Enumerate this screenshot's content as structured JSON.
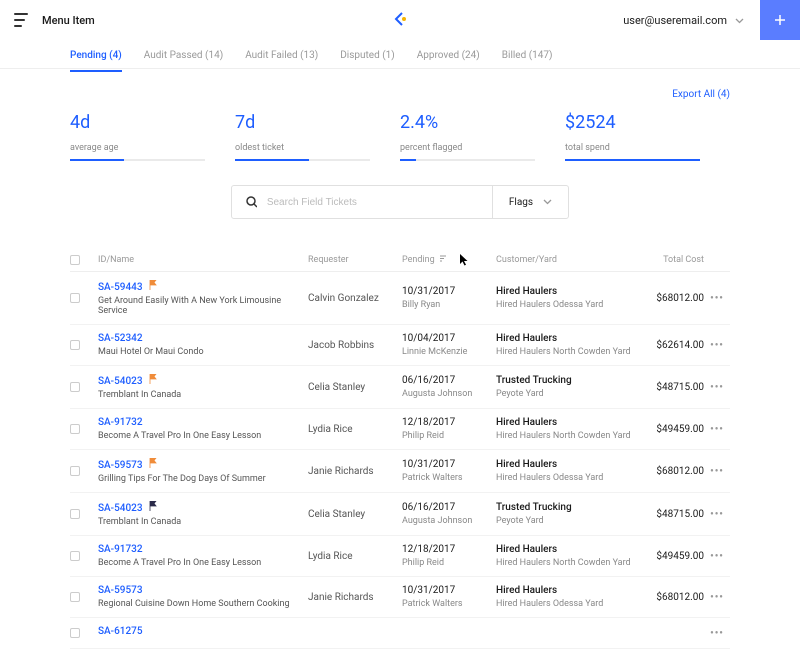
{
  "header": {
    "menu_label": "Menu Item",
    "user_email": "user@useremail.com"
  },
  "tabs": [
    {
      "label": "Pending (4)",
      "active": true
    },
    {
      "label": "Audit Passed (14)",
      "active": false
    },
    {
      "label": "Audit Failed (13)",
      "active": false
    },
    {
      "label": "Disputed (1)",
      "active": false
    },
    {
      "label": "Approved (24)",
      "active": false
    },
    {
      "label": "Billed (147)",
      "active": false
    }
  ],
  "export_label": "Export All (4)",
  "stats": [
    {
      "value": "4d",
      "label": "average age"
    },
    {
      "value": "7d",
      "label": "oldest ticket"
    },
    {
      "value": "2.4%",
      "label": "percent flagged"
    },
    {
      "value": "$2524",
      "label": "total spend"
    }
  ],
  "search": {
    "placeholder": "Search Field Tickets",
    "flags_label": "Flags"
  },
  "columns": {
    "id": "ID/Name",
    "requester": "Requester",
    "pending": "Pending",
    "customer": "Customer/Yard",
    "cost": "Total Cost"
  },
  "rows": [
    {
      "id": "SA-59443",
      "flag": "orange",
      "name": "Get Around Easily With A New York Limousine Service",
      "requester": "Calvin Gonzalez",
      "date": "10/31/2017",
      "person": "Billy Ryan",
      "customer": "Hired Haulers",
      "yard": "Hired Haulers Odessa Yard",
      "cost": "$68012.00"
    },
    {
      "id": "SA-52342",
      "flag": "",
      "name": "Maui Hotel Or Maui Condo",
      "requester": "Jacob Robbins",
      "date": "10/04/2017",
      "person": "Linnie McKenzie",
      "customer": "Hired Haulers",
      "yard": "Hired Haulers North Cowden Yard",
      "cost": "$62614.00"
    },
    {
      "id": "SA-54023",
      "flag": "orange",
      "name": "Tremblant In Canada",
      "requester": "Celia Stanley",
      "date": "06/16/2017",
      "person": "Augusta Johnson",
      "customer": "Trusted Trucking",
      "yard": "Peyote Yard",
      "cost": "$48715.00"
    },
    {
      "id": "SA-91732",
      "flag": "",
      "name": "Become A Travel Pro In One Easy Lesson",
      "requester": "Lydia Rice",
      "date": "12/18/2017",
      "person": "Philip Reid",
      "customer": "Hired Haulers",
      "yard": "Hired Haulers North Cowden Yard",
      "cost": "$49459.00"
    },
    {
      "id": "SA-59573",
      "flag": "orange",
      "name": "Grilling Tips For The Dog Days Of Summer",
      "requester": "Janie Richards",
      "date": "10/31/2017",
      "person": "Patrick Walters",
      "customer": "Hired Haulers",
      "yard": "Hired Haulers Odessa Yard",
      "cost": "$68012.00"
    },
    {
      "id": "SA-54023",
      "flag": "dark",
      "name": "Tremblant In Canada",
      "requester": "Celia Stanley",
      "date": "06/16/2017",
      "person": "Augusta Johnson",
      "customer": "Trusted Trucking",
      "yard": "Peyote Yard",
      "cost": "$48715.00"
    },
    {
      "id": "SA-91732",
      "flag": "",
      "name": "Become A Travel Pro In One Easy Lesson",
      "requester": "Lydia Rice",
      "date": "12/18/2017",
      "person": "Philip Reid",
      "customer": "Hired Haulers",
      "yard": "Hired Haulers North Cowden Yard",
      "cost": "$49459.00"
    },
    {
      "id": "SA-59573",
      "flag": "",
      "name": "Regional Cuisine Down Home Southern Cooking",
      "requester": "Janie Richards",
      "date": "10/31/2017",
      "person": "Patrick Walters",
      "customer": "Hired Haulers",
      "yard": "Hired Haulers Odessa Yard",
      "cost": "$68012.00"
    },
    {
      "id": "SA-61275",
      "flag": "",
      "name": "",
      "requester": "",
      "date": "",
      "person": "",
      "customer": "",
      "yard": "",
      "cost": ""
    }
  ]
}
